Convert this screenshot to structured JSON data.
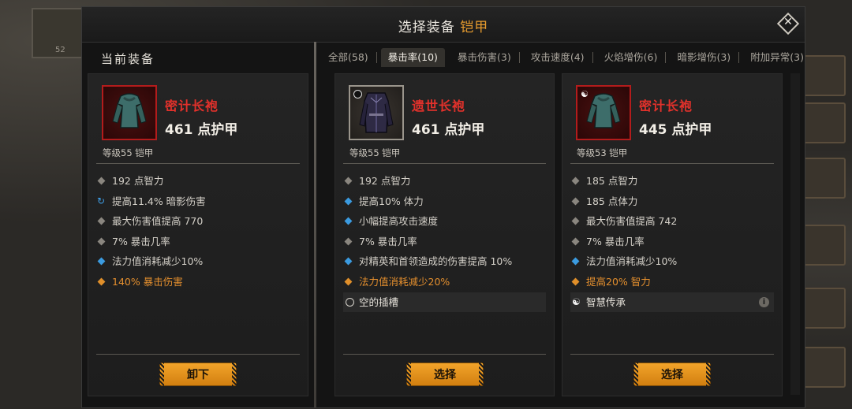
{
  "header": {
    "title_prefix": "选择装备",
    "title_accent": "铠甲",
    "close_label": "✕"
  },
  "current": {
    "section_title": "当前装备",
    "item": {
      "name": "密计长袍",
      "armor": "461 点护甲",
      "level": "等级55 铠甲",
      "stats": [
        {
          "text": "192 点智力",
          "bullet": "grey"
        },
        {
          "text": "提高11.4% 暗影伤害",
          "bullet": "refresh"
        },
        {
          "text": "最大伤害值提高 770",
          "bullet": "grey"
        },
        {
          "text": "7% 暴击几率",
          "bullet": "grey"
        },
        {
          "text": "法力值消耗减少10%",
          "bullet": "blue"
        },
        {
          "text": "140% 暴击伤害",
          "bullet": "orange"
        }
      ],
      "button": "卸下"
    }
  },
  "tabs": [
    {
      "label": "全部(58)",
      "active": false
    },
    {
      "label": "暴击率(10)",
      "active": true
    },
    {
      "label": "暴击伤害(3)",
      "active": false
    },
    {
      "label": "攻击速度(4)",
      "active": false
    },
    {
      "label": "火焰增伤(6)",
      "active": false
    },
    {
      "label": "暗影增伤(3)",
      "active": false
    },
    {
      "label": "附加异常(3)",
      "active": false
    }
  ],
  "candidates": [
    {
      "name": "遗世长袍",
      "armor": "461 点护甲",
      "level": "等级55 铠甲",
      "stats": [
        {
          "text": "192 点智力",
          "bullet": "grey"
        },
        {
          "text": "提高10% 体力",
          "bullet": "blue"
        },
        {
          "text": "小幅提高攻击速度",
          "bullet": "blue"
        },
        {
          "text": "7% 暴击几率",
          "bullet": "grey"
        },
        {
          "text": "对精英和首领造成的伤害提高 10%",
          "bullet": "blue"
        },
        {
          "text": "法力值消耗减少20%",
          "bullet": "orange"
        }
      ],
      "slot": "空的插槽",
      "button": "选择"
    },
    {
      "name": "密计长袍",
      "armor": "445 点护甲",
      "level": "等级53 铠甲",
      "stats": [
        {
          "text": "185 点智力",
          "bullet": "grey"
        },
        {
          "text": "185 点体力",
          "bullet": "grey"
        },
        {
          "text": "最大伤害值提高 742",
          "bullet": "grey"
        },
        {
          "text": "7% 暴击几率",
          "bullet": "grey"
        },
        {
          "text": "法力值消耗减少10%",
          "bullet": "blue"
        },
        {
          "text": "提高20% 智力",
          "bullet": "orange"
        }
      ],
      "slot": "智慧传承",
      "button": "选择"
    }
  ],
  "background": {
    "corner_number": "52"
  },
  "colors": {
    "accent": "#e69b2e",
    "item_name": "#e2312b",
    "legendary_stat": "#e48f2e",
    "magic_bullet": "#3b9be0",
    "button": "#f2a42a"
  }
}
